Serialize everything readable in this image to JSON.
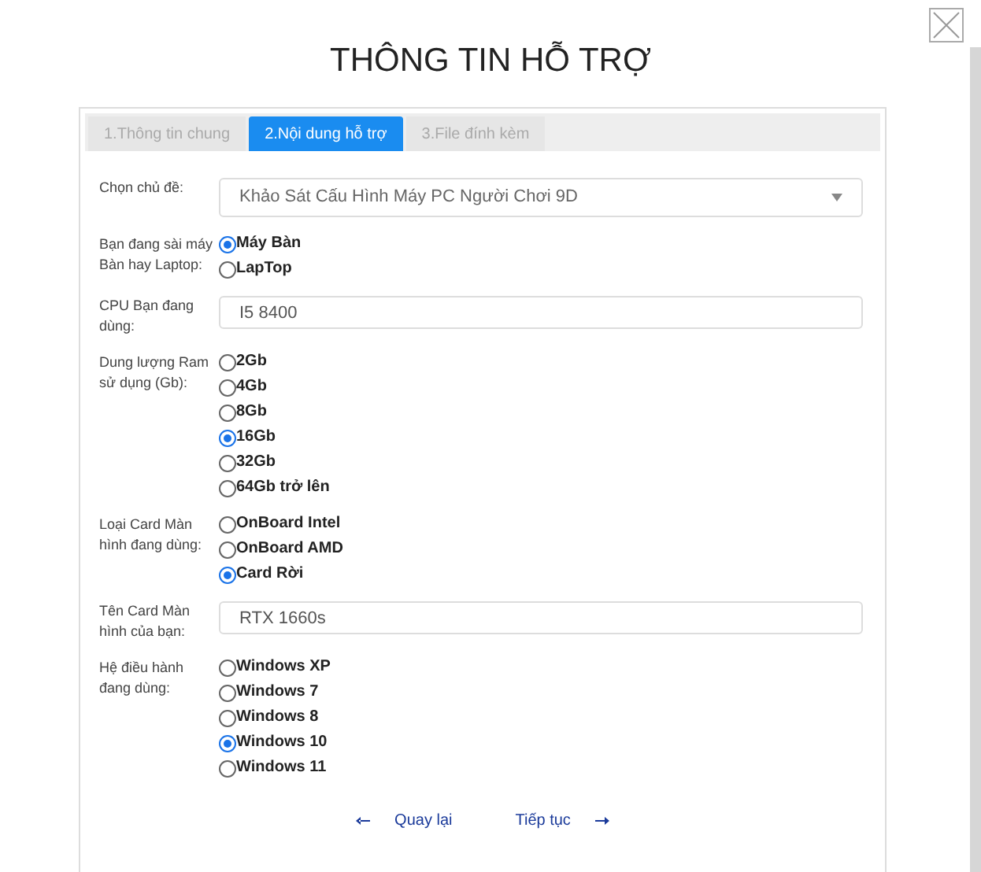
{
  "title": "THÔNG TIN HỖ TRỢ",
  "tabs": [
    {
      "label": "1.Thông tin chung",
      "selected": false
    },
    {
      "label": "2.Nội dung hỗ trợ",
      "selected": true
    },
    {
      "label": "3.File đính kèm",
      "selected": false
    }
  ],
  "fields": [
    {
      "kind": "select",
      "label": "Chọn chủ đề:",
      "value": "Khảo Sát Cấu Hình Máy PC Người Chơi 9D"
    },
    {
      "kind": "radio",
      "label": "Bạn đang sài máy Bàn hay Laptop:",
      "options": [
        {
          "label": "Máy Bàn",
          "selected": true
        },
        {
          "label": "LapTop",
          "selected": false
        }
      ]
    },
    {
      "kind": "text",
      "label": "CPU Bạn đang dùng:",
      "value": "I5 8400"
    },
    {
      "kind": "radio",
      "label": "Dung lượng Ram sử dụng (Gb):",
      "options": [
        {
          "label": "2Gb",
          "selected": false
        },
        {
          "label": "4Gb",
          "selected": false
        },
        {
          "label": "8Gb",
          "selected": false
        },
        {
          "label": "16Gb",
          "selected": true
        },
        {
          "label": "32Gb",
          "selected": false
        },
        {
          "label": "64Gb trở lên",
          "selected": false
        }
      ]
    },
    {
      "kind": "radio",
      "label": "Loại Card Màn hình đang dùng:",
      "options": [
        {
          "label": "OnBoard Intel",
          "selected": false
        },
        {
          "label": "OnBoard AMD",
          "selected": false
        },
        {
          "label": "Card Rời",
          "selected": true
        }
      ]
    },
    {
      "kind": "text",
      "label": "Tên Card Màn hình của bạn:",
      "value": "RTX 1660s"
    },
    {
      "kind": "radio",
      "label": "Hệ điều hành đang dùng:",
      "options": [
        {
          "label": "Windows XP",
          "selected": false
        },
        {
          "label": "Windows 7",
          "selected": false
        },
        {
          "label": "Windows 8",
          "selected": false
        },
        {
          "label": "Windows 10",
          "selected": true
        },
        {
          "label": "Windows 11",
          "selected": false
        }
      ]
    }
  ],
  "nav": {
    "back": "Quay lại",
    "next": "Tiếp tục"
  }
}
